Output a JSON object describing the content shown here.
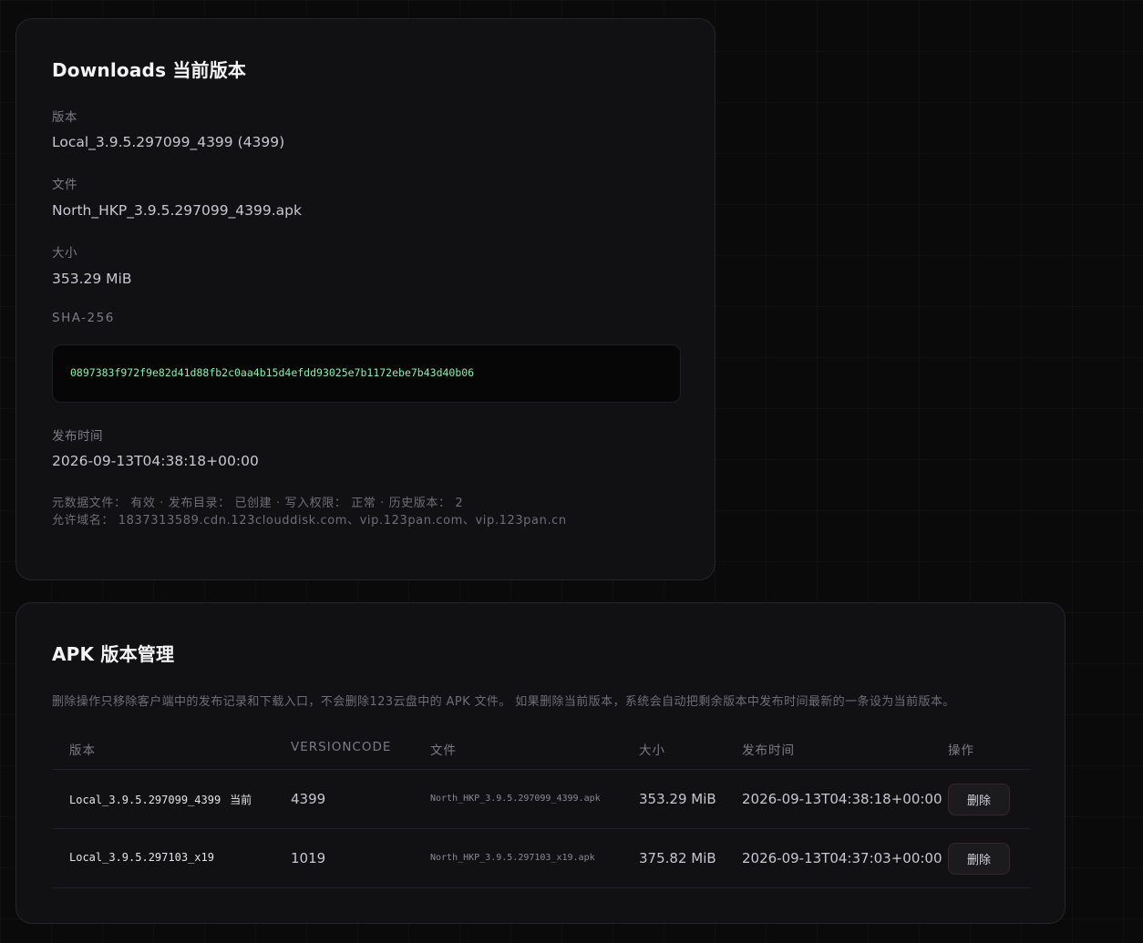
{
  "current": {
    "title": "Downloads 当前版本",
    "version_label": "版本",
    "version_value": "Local_3.9.5.297099_4399 (4399)",
    "file_label": "文件",
    "file_value": "North_HKP_3.9.5.297099_4399.apk",
    "size_label": "大小",
    "size_value": "353.29 MiB",
    "sha_label": "SHA-256",
    "sha_value": "0897383f972f9e82d41d88fb2c0aa4b15d4efdd93025e7b1172ebe7b43d40b06",
    "time_label": "发布时间",
    "time_value": "2026-09-13T04:38:18+00:00",
    "meta_status": "元数据文件： 有效 · 发布目录： 已创建 · 写入权限： 正常 · 历史版本： 2",
    "meta_domains": "允许域名： 1837313589.cdn.123clouddisk.com、vip.123pan.com、vip.123pan.cn"
  },
  "versions": {
    "title": "APK 版本管理",
    "description": "删除操作只移除客户端中的发布记录和下载入口，不会删除123云盘中的 APK 文件。 如果删除当前版本，系统会自动把剩余版本中发布时间最新的一条设为当前版本。",
    "columns": [
      "版本",
      "VERSIONCODE",
      "文件",
      "大小",
      "发布时间",
      "操作"
    ],
    "rows": [
      {
        "version": "Local_3.9.5.297099_4399",
        "badge": "当前",
        "code": "4399",
        "file": "North_HKP_3.9.5.297099_4399.apk",
        "size": "353.29 MiB",
        "time": "2026-09-13T04:38:18+00:00",
        "action": "删除"
      },
      {
        "version": "Local_3.9.5.297103_x19",
        "badge": "",
        "code": "1019",
        "file": "North_HKP_3.9.5.297103_x19.apk",
        "size": "375.82 MiB",
        "time": "2026-09-13T04:37:03+00:00",
        "action": "删除"
      }
    ]
  },
  "colors": {
    "background": "#0a0a0b",
    "card": "#111113",
    "hash_text": "#86efac",
    "delete_border": "#3a2629"
  }
}
